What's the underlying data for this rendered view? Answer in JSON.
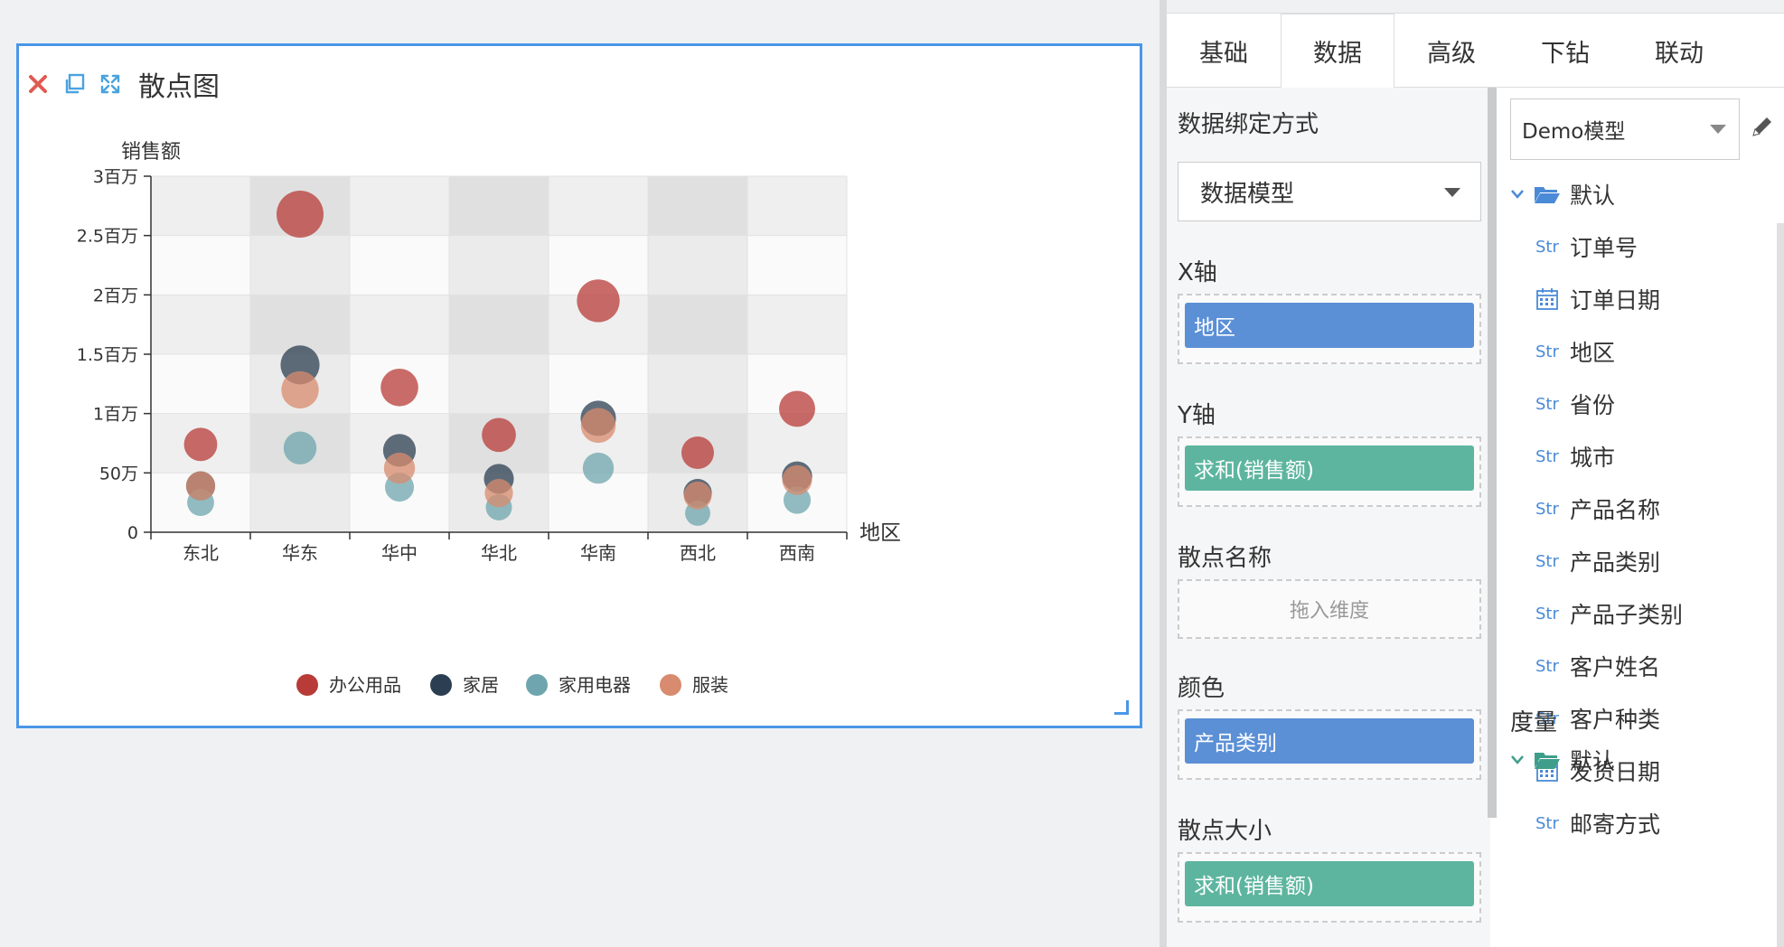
{
  "chart_card": {
    "title": "散点图",
    "icons": {
      "close": "close-icon",
      "copy": "copy-icon",
      "expand": "expand-icon"
    }
  },
  "chart_data": {
    "type": "scatter",
    "ylabel": "销售额",
    "xlabel": "地区",
    "categories": [
      "东北",
      "华东",
      "华中",
      "华北",
      "华南",
      "西北",
      "西南"
    ],
    "y_ticks": [
      {
        "value": 0,
        "label": "0"
      },
      {
        "value": 500000,
        "label": "50万"
      },
      {
        "value": 1000000,
        "label": "1百万"
      },
      {
        "value": 1500000,
        "label": "1.5百万"
      },
      {
        "value": 2000000,
        "label": "2百万"
      },
      {
        "value": 2500000,
        "label": "2.5百万"
      },
      {
        "value": 3000000,
        "label": "3百万"
      }
    ],
    "ylim": [
      0,
      3000000
    ],
    "legend_position": "bottom",
    "series": [
      {
        "name": "办公用品",
        "color": "#b83b37",
        "values": [
          740000,
          2680000,
          1220000,
          820000,
          1950000,
          670000,
          1040000
        ]
      },
      {
        "name": "家居",
        "color": "#2c3f52",
        "values": [
          390000,
          1410000,
          690000,
          450000,
          960000,
          330000,
          470000
        ]
      },
      {
        "name": "家用电器",
        "color": "#6ea5ae",
        "values": [
          250000,
          710000,
          380000,
          210000,
          540000,
          160000,
          270000
        ]
      },
      {
        "name": "服装",
        "color": "#d88b6e",
        "values": [
          390000,
          1200000,
          540000,
          330000,
          900000,
          310000,
          440000
        ]
      }
    ]
  },
  "panel": {
    "tabs": [
      {
        "label": "基础",
        "active": false
      },
      {
        "label": "数据",
        "active": true
      },
      {
        "label": "高级",
        "active": false
      },
      {
        "label": "下钻",
        "active": false
      },
      {
        "label": "联动",
        "active": false
      }
    ],
    "binding_label": "数据绑定方式",
    "binding_value": "数据模型",
    "x_axis": {
      "label": "X轴",
      "field": "地区"
    },
    "y_axis": {
      "label": "Y轴",
      "field": "求和(销售额)"
    },
    "scatter_name": {
      "label": "散点名称",
      "hint": "拖入维度"
    },
    "color": {
      "label": "颜色",
      "field": "产品类别"
    },
    "scatter_size": {
      "label": "散点大小",
      "field": "求和(销售额)"
    },
    "model": "Demo模型",
    "dimension_folder": "默认",
    "dimensions": [
      {
        "type": "Str",
        "name": "订单号"
      },
      {
        "type": "date",
        "name": "订单日期"
      },
      {
        "type": "Str",
        "name": "地区"
      },
      {
        "type": "Str",
        "name": "省份"
      },
      {
        "type": "Str",
        "name": "城市"
      },
      {
        "type": "Str",
        "name": "产品名称"
      },
      {
        "type": "Str",
        "name": "产品类别"
      },
      {
        "type": "Str",
        "name": "产品子类别"
      },
      {
        "type": "Str",
        "name": "客户姓名"
      },
      {
        "type": "Str",
        "name": "客户种类"
      },
      {
        "type": "date",
        "name": "发货日期"
      },
      {
        "type": "Str",
        "name": "邮寄方式"
      }
    ],
    "measure_label": "度量",
    "measure_folder": "默认",
    "colors": {
      "accent": "#4a97e8",
      "pill_blue": "#5b8fd6",
      "pill_green": "#5db59f"
    }
  }
}
